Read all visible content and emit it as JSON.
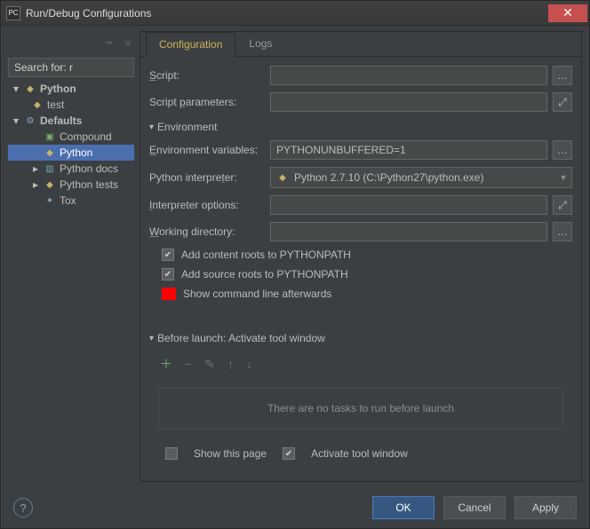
{
  "window": {
    "title": "Run/Debug Configurations",
    "icon_text": "PC"
  },
  "search": {
    "label": "Search for: r"
  },
  "tree": {
    "python": "Python",
    "test": "test",
    "defaults": "Defaults",
    "compound": "Compound",
    "python2": "Python",
    "pydocs": "Python docs",
    "pytests": "Python tests",
    "tox": "Tox"
  },
  "tabs": {
    "configuration": "Configuration",
    "logs": "Logs"
  },
  "form": {
    "script_label": "Script:",
    "params_label": "Script parameters:",
    "env_header": "Environment",
    "envvars_label": "Environment variables:",
    "envvars_value": "PYTHONUNBUFFERED=1",
    "interp_label": "Python interpreter:",
    "interp_value": "Python 2.7.10 (C:\\Python27\\python.exe)",
    "interp_opts_label": "Interpreter options:",
    "wdir_label": "Working directory:",
    "add_content": "Add content roots to PYTHONPATH",
    "add_source": "Add source roots to PYTHONPATH",
    "show_cmd": "Show command line afterwards",
    "before_launch_header": "Before launch: Activate tool window",
    "no_tasks": "There are no tasks to run before launch",
    "show_page": "Show this page",
    "activate_tool": "Activate tool window"
  },
  "footer": {
    "ok": "OK",
    "cancel": "Cancel",
    "apply": "Apply"
  }
}
